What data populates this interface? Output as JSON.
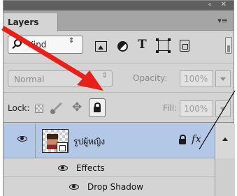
{
  "panel": {
    "tab_label": "Layers",
    "collapse_glyph": "«",
    "close_glyph": "✕",
    "menu_glyph": "▾≡"
  },
  "filter": {
    "kind_label": "Kind",
    "kind_arrows": "⇕",
    "type_glyph": "T"
  },
  "blend": {
    "mode": "Normal",
    "arrows": "⇕",
    "opacity_label": "Opacity:",
    "opacity_value": "100%"
  },
  "lock": {
    "label": "Lock:",
    "move_glyph": "✥",
    "fill_label": "Fill:",
    "fill_value": "100%"
  },
  "layers": {
    "selected_layer_name": "รูปผู้หญิง",
    "fx_label": "fx",
    "effects_label": "Effects",
    "effect_items": [
      "Drop Shadow"
    ]
  },
  "colors": {
    "panel_bg": "#d4d4d4",
    "selected_row": "#b3c8e6",
    "annotation_arrow": "#e8201a"
  }
}
